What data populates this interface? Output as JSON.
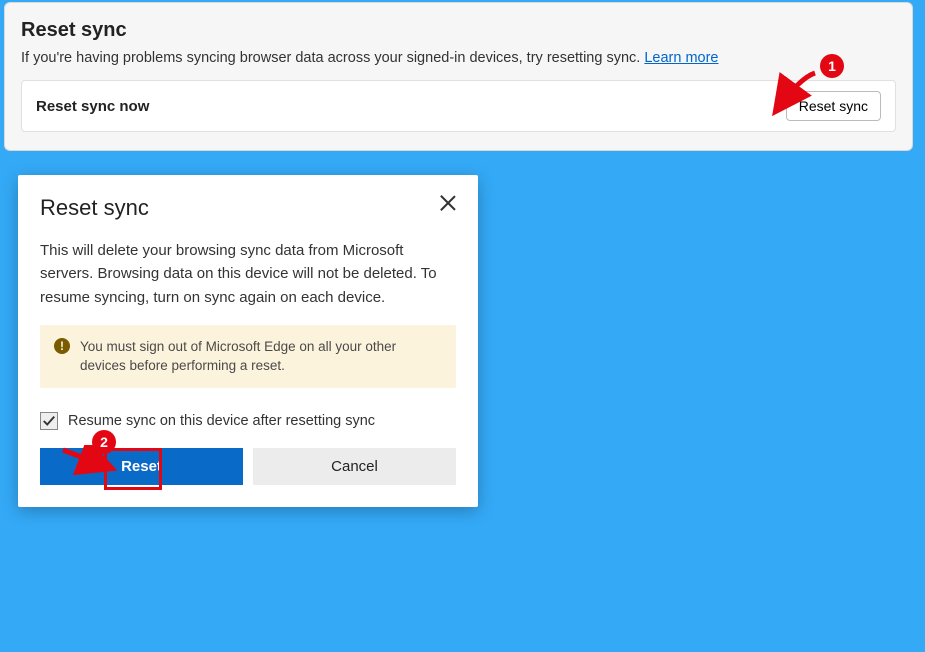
{
  "settings": {
    "title": "Reset sync",
    "description": "If you're having problems syncing browser data across your signed-in devices, try resetting sync. ",
    "learn_more": "Learn more",
    "row_label": "Reset sync now",
    "button_label": "Reset sync"
  },
  "dialog": {
    "title": "Reset sync",
    "body": "This will delete your browsing sync data from Microsoft servers. Browsing data on this device will not be deleted. To resume syncing, turn on sync again on each device.",
    "warning": "You must sign out of Microsoft Edge on all your other devices before performing a reset.",
    "checkbox_label": "Resume sync on this device after resetting sync",
    "checkbox_checked": true,
    "reset_label": "Reset",
    "cancel_label": "Cancel"
  },
  "annotations": {
    "badge_1": "1",
    "badge_2": "2"
  }
}
